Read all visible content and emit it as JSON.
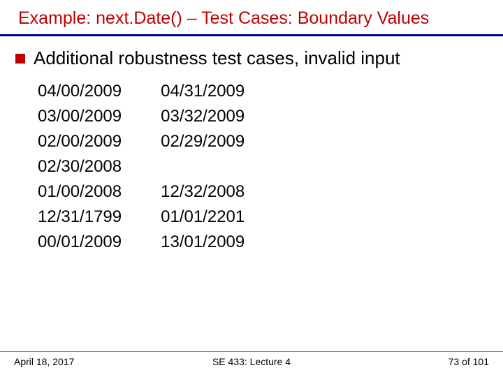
{
  "title": "Example: next.Date() – Test Cases: Boundary Values",
  "bullet": "Additional robustness test cases, invalid input",
  "columns": [
    [
      "04/00/2009",
      "03/00/2009",
      "02/00/2009",
      "02/30/2008",
      "01/00/2008",
      "12/31/1799",
      "00/01/2009"
    ],
    [
      "04/31/2009",
      "03/32/2009",
      "02/29/2009",
      "",
      "12/32/2008",
      "01/01/2201",
      "13/01/2009"
    ]
  ],
  "footer": {
    "date": "April 18, 2017",
    "center": "SE 433: Lecture 4",
    "page": "73 of 101"
  }
}
